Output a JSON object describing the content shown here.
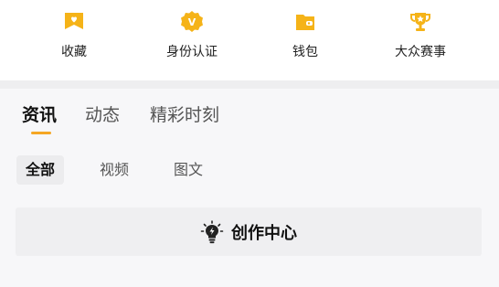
{
  "quick_actions": [
    {
      "label": "收藏",
      "icon": "favorite-heart-icon"
    },
    {
      "label": "身份认证",
      "icon": "verified-v-badge-icon"
    },
    {
      "label": "钱包",
      "icon": "wallet-icon"
    },
    {
      "label": "大众赛事",
      "icon": "trophy-icon"
    }
  ],
  "tabs": [
    {
      "label": "资讯",
      "active": true
    },
    {
      "label": "动态",
      "active": false
    },
    {
      "label": "精彩时刻",
      "active": false
    }
  ],
  "subtabs": [
    {
      "label": "全部",
      "active": true
    },
    {
      "label": "视频",
      "active": false
    },
    {
      "label": "图文",
      "active": false
    }
  ],
  "creation_center": {
    "label": "创作中心",
    "icon": "lightbulb-bolt-icon"
  },
  "colors": {
    "accent": "#f5a623",
    "icon_gold": "#f5b318"
  }
}
